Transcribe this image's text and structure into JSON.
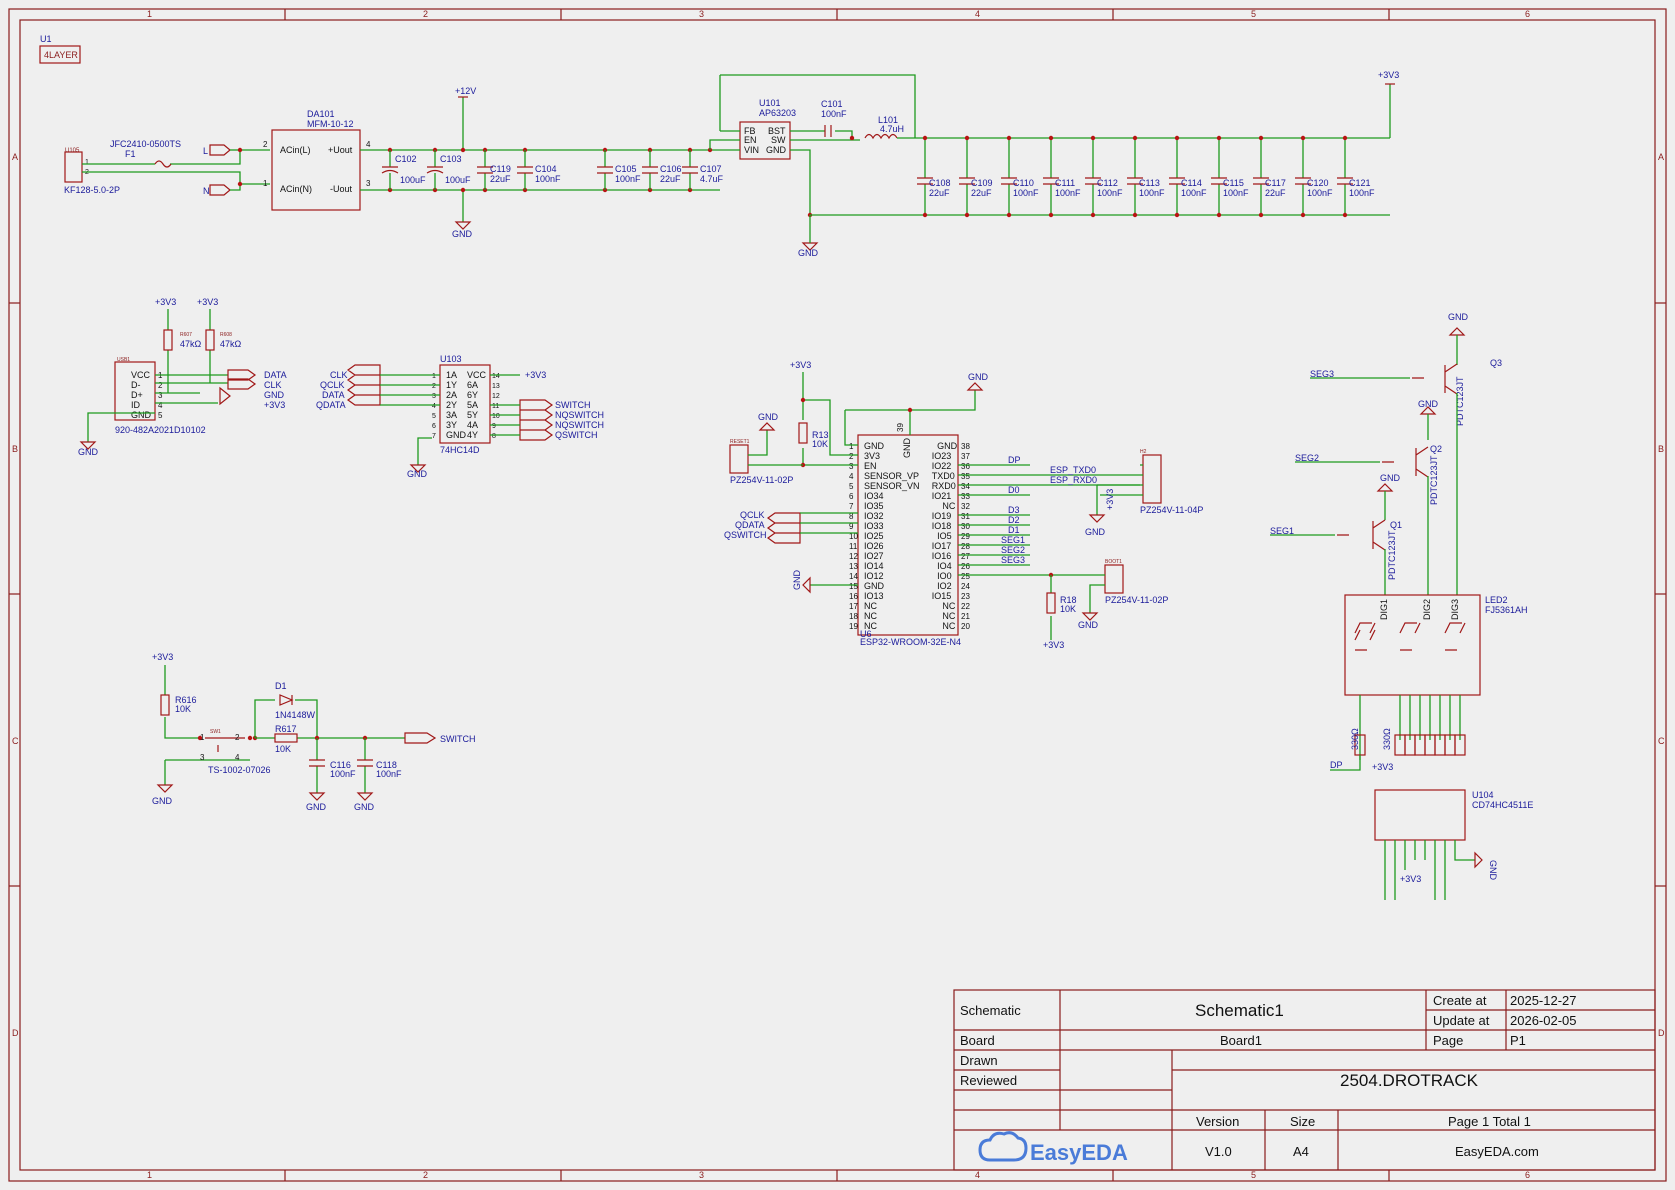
{
  "rulers": {
    "cols": [
      "1",
      "2",
      "3",
      "4",
      "5",
      "6"
    ],
    "rows": [
      "A",
      "B",
      "C",
      "D"
    ]
  },
  "title_block": {
    "schematic_label": "Schematic",
    "schematic_name": "Schematic1",
    "create_label": "Create at",
    "create_date": "2025-12-27",
    "update_label": "Update at",
    "update_date": "2026-02-05",
    "board_label": "Board",
    "board_name": "Board1",
    "page_label": "Page",
    "page_value": "P1",
    "drawn_label": "Drawn",
    "reviewed_label": "Reviewed",
    "project": "2504.DROTRACK",
    "version_label": "Version",
    "version_value": "V1.0",
    "size_label": "Size",
    "size_value": "A4",
    "page_total": "Page  1  Total  1",
    "site": "EasyEDA.com",
    "logo_text": "EasyEDA"
  },
  "u1": {
    "ref": "U1",
    "value": "4LAYER"
  },
  "power": {
    "ref_fuse": "F1",
    "fuse_val": "JFC2410-0500TS",
    "conn_ref": "U105",
    "conn_val": "KF128-5.0-2P",
    "L": "L",
    "N": "N",
    "da101": "DA101",
    "da101_val": "MFM-10-12",
    "acin_l": "ACin(L)",
    "acin_n": "ACin(N)",
    "uout_p": "+Uout",
    "uout_n": "-Uout",
    "v12": "+12V",
    "gnd": "GND",
    "c102": "C102",
    "c102v": "100uF",
    "c103": "C103",
    "c103v": "100uF",
    "c119": "C119",
    "c119v": "22uF",
    "c104": "C104",
    "c104v": "100nF",
    "c105": "C105",
    "c105v": "100nF",
    "c106": "C106",
    "c106v": "22uF",
    "c107": "C107",
    "c107v": "4.7uF",
    "u101": "U101",
    "u101v": "AP63203",
    "fb": "FB",
    "en": "EN",
    "vin": "VIN",
    "bst": "BST",
    "sw": "SW",
    "gndp": "GND",
    "c101": "C101",
    "c101v": "100nF",
    "l101": "L101",
    "l101v": "4.7uH",
    "v33": "+3V3",
    "caps": [
      {
        "r": "C108",
        "v": "22uF"
      },
      {
        "r": "C109",
        "v": "22uF"
      },
      {
        "r": "C110",
        "v": "100nF"
      },
      {
        "r": "C111",
        "v": "100nF"
      },
      {
        "r": "C112",
        "v": "100nF"
      },
      {
        "r": "C113",
        "v": "100nF"
      },
      {
        "r": "C114",
        "v": "100nF"
      },
      {
        "r": "C115",
        "v": "100nF"
      },
      {
        "r": "C117",
        "v": "22uF"
      },
      {
        "r": "C120",
        "v": "100nF"
      },
      {
        "r": "C121",
        "v": "100nF"
      }
    ]
  },
  "usb": {
    "ref": "USB1",
    "val": "920-482A2021D10102",
    "pins": [
      "VCC",
      "D-",
      "D+",
      "ID",
      "GND"
    ],
    "r1": "R607",
    "r1v": "47kΩ",
    "r2": "R608",
    "r2v": "47kΩ",
    "nets": [
      "DATA",
      "CLK",
      "GND",
      "+3V3"
    ]
  },
  "hc14": {
    "ref": "U103",
    "val": "74HC14D",
    "left": [
      "1A",
      "1Y",
      "2A",
      "2Y",
      "3A",
      "3Y",
      "GND"
    ],
    "right": [
      "VCC",
      "6A",
      "6Y",
      "5A",
      "5Y",
      "4A",
      "4Y"
    ],
    "in_nets": [
      "CLK",
      "QCLK",
      "DATA",
      "QDATA"
    ],
    "out_nets": [
      "SWITCH",
      "NQSWITCH",
      "NQSWITCH",
      "QSWITCH"
    ]
  },
  "esp": {
    "ref": "U6",
    "val": "ESP32-WROOM-32E-N4",
    "left": [
      "GND",
      "3V3",
      "EN",
      "SENSOR_VP",
      "SENSOR_VN",
      "IO34",
      "IO35",
      "IO32",
      "IO33",
      "IO25",
      "IO26",
      "IO27",
      "IO14",
      "IO12",
      "GND",
      "IO13",
      "NC",
      "NC",
      "NC"
    ],
    "right": [
      "GND",
      "IO23",
      "IO22",
      "TXD0",
      "RXD0",
      "IO21",
      "NC",
      "IO19",
      "IO18",
      "IO5",
      "IO17",
      "IO16",
      "IO4",
      "IO0",
      "IO2",
      "IO15",
      "NC",
      "NC",
      "NC"
    ],
    "gnd_top": "GND",
    "pin39": "39",
    "r13": "R13",
    "r13v": "10K",
    "r18": "R18",
    "r18v": "10K",
    "reset": "RESET1",
    "resetv": "PZ254V-11-02P",
    "boot": "BOOT1",
    "bootv": "PZ254V-11-02P",
    "h2": "H2",
    "h2v": "PZ254V-11-04P",
    "q_nets": [
      "QCLK",
      "QDATA",
      "QSWITCH"
    ],
    "out_nets": [
      "DP",
      "ESP_TXD0",
      "ESP_RXD0",
      "D0",
      "D3",
      "D2",
      "D1",
      "SEG1",
      "SEG2",
      "SEG3"
    ]
  },
  "sw": {
    "r616": "R616",
    "r616v": "10K",
    "r617": "R617",
    "r617v": "10K",
    "d1": "D1",
    "d1v": "1N4148W",
    "sw1": "SW1",
    "sw1v": "TS-1002-07026",
    "c116": "C116",
    "c116v": "100nF",
    "c118": "C118",
    "c118v": "100nF",
    "net": "SWITCH"
  },
  "display": {
    "led": "LED2",
    "ledv": "FJ5361AH",
    "q1": "Q1",
    "q2": "Q2",
    "q3": "Q3",
    "qv": "PDTC123JT",
    "segs": [
      "SEG1",
      "SEG2",
      "SEG3"
    ],
    "dig": [
      "DIG1",
      "DIG2",
      "DIG3"
    ],
    "u104": "U104",
    "u104v": "CD74HC4511E",
    "dp": "DP",
    "res": "330Ω"
  }
}
